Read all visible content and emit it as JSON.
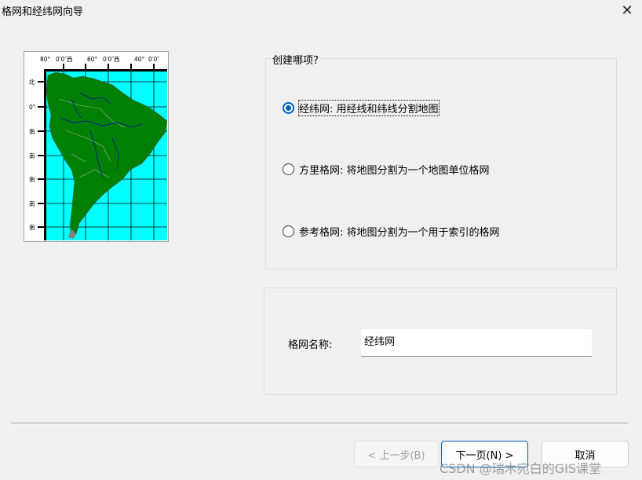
{
  "window": {
    "title": "格网和经纬网向导",
    "close_glyph": "✕"
  },
  "map_preview": {
    "top_labels": [
      "80°",
      "0′0″西",
      "60°",
      "0′0″西",
      "40°",
      "0′0″"
    ],
    "left_labels": [
      "北",
      "0°",
      "南",
      "南",
      "南",
      "南",
      "南"
    ],
    "colors": {
      "ocean": "#00ffff",
      "land": "#008000",
      "rivers": "#0000c0",
      "borders": "#b0b0b0",
      "grid": "#000000"
    }
  },
  "create_group": {
    "legend": "创建哪项?",
    "options": [
      {
        "label": "经纬网: 用经线和纬线分割地图",
        "checked": true
      },
      {
        "label": "方里格网: 将地图分割为一个地图单位格网",
        "checked": false
      },
      {
        "label": "参考格网: 将地图分割为一个用于索引的格网",
        "checked": false
      }
    ]
  },
  "name_group": {
    "label": "格网名称:",
    "value": "经纬网"
  },
  "buttons": {
    "back": "< 上一步(B)",
    "next": "下一页(N) >",
    "cancel": "取消"
  },
  "watermark": "CSDN @瑞木宛白的GIS课堂",
  "colors": {
    "accent": "#005fb8",
    "background": "#f0f0f0"
  }
}
